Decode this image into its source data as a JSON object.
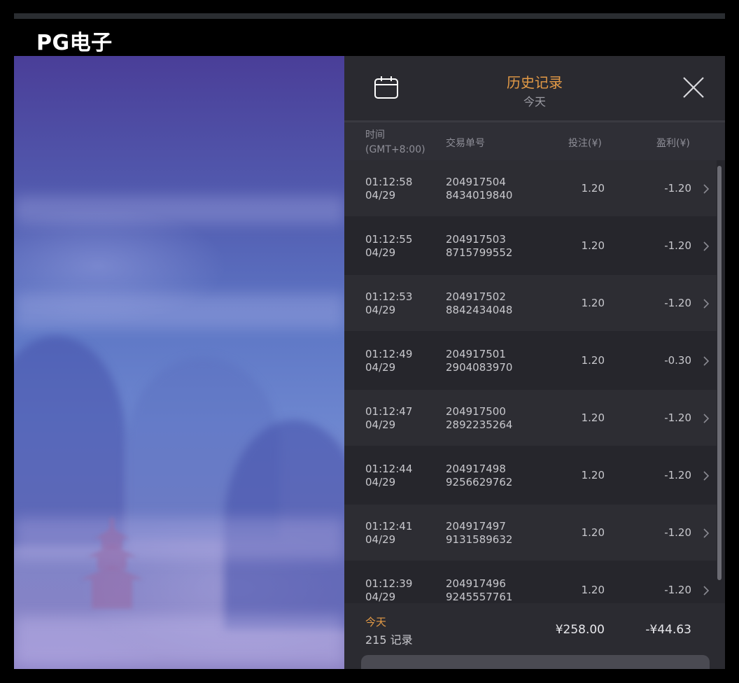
{
  "app": {
    "brand": "PG电子"
  },
  "panel": {
    "title": "历史记录",
    "subtitle": "今天",
    "icons": {
      "calendar": "calendar-icon",
      "close": "close-icon",
      "row_chevron": "chevron-right-icon"
    },
    "colors": {
      "accent": "#e39a46",
      "panel_bg": "#26262c",
      "row_alt": "#2d2d33"
    }
  },
  "columns": {
    "time": "时间",
    "timezone": "(GMT+8:00)",
    "order_id": "交易单号",
    "bet": "投注(¥)",
    "profit": "盈利(¥)"
  },
  "records": [
    {
      "time": "01:12:58",
      "date": "04/29",
      "id_line1": "204917504",
      "id_line2": "8434019840",
      "bet": "1.20",
      "profit": "-1.20"
    },
    {
      "time": "01:12:55",
      "date": "04/29",
      "id_line1": "204917503",
      "id_line2": "8715799552",
      "bet": "1.20",
      "profit": "-1.20"
    },
    {
      "time": "01:12:53",
      "date": "04/29",
      "id_line1": "204917502",
      "id_line2": "8842434048",
      "bet": "1.20",
      "profit": "-1.20"
    },
    {
      "time": "01:12:49",
      "date": "04/29",
      "id_line1": "204917501",
      "id_line2": "2904083970",
      "bet": "1.20",
      "profit": "-0.30"
    },
    {
      "time": "01:12:47",
      "date": "04/29",
      "id_line1": "204917500",
      "id_line2": "2892235264",
      "bet": "1.20",
      "profit": "-1.20"
    },
    {
      "time": "01:12:44",
      "date": "04/29",
      "id_line1": "204917498",
      "id_line2": "9256629762",
      "bet": "1.20",
      "profit": "-1.20"
    },
    {
      "time": "01:12:41",
      "date": "04/29",
      "id_line1": "204917497",
      "id_line2": "9131589632",
      "bet": "1.20",
      "profit": "-1.20"
    },
    {
      "time": "01:12:39",
      "date": "04/29",
      "id_line1": "204917496",
      "id_line2": "9245557761",
      "bet": "1.20",
      "profit": "-1.20"
    }
  ],
  "summary": {
    "label": "今天",
    "count": "215 记录",
    "total_bet": "¥258.00",
    "total_profit": "-¥44.63"
  },
  "notice": {
    "text": ""
  }
}
